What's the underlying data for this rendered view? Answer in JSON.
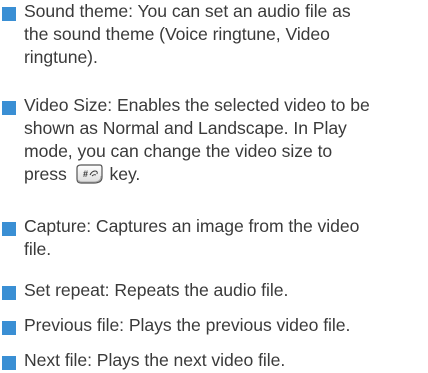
{
  "items": [
    {
      "lines": [
        "Sound theme: You can set an audio file as",
        "the sound theme (Voice ringtune, Video",
        "ringtune)."
      ]
    },
    {
      "lines": [
        "Video Size: Enables the selected video to be",
        "shown as Normal and Landscape. In Play",
        "mode, you can change the video size to"
      ],
      "last_line_before": "press",
      "last_line_after": "key.",
      "key_icon": "hash-key-icon"
    },
    {
      "lines": [
        "Capture: Captures an image from the video",
        "file."
      ]
    },
    {
      "lines": [
        "Set repeat: Repeats the audio file."
      ]
    },
    {
      "lines": [
        "Previous file: Plays the previous video file."
      ]
    },
    {
      "lines": [
        "Next file: Plays the next video file."
      ]
    }
  ],
  "colors": {
    "bullet": "#3a8fd4",
    "text": "#3a3a3a"
  }
}
